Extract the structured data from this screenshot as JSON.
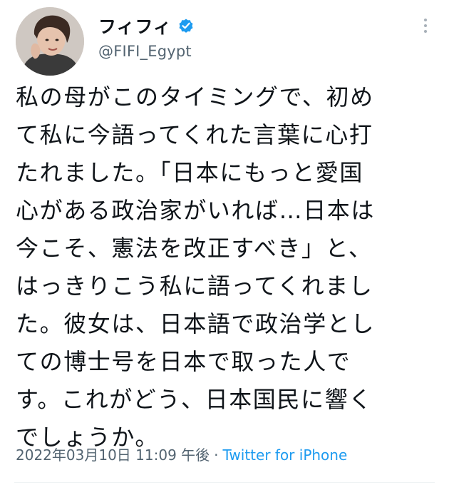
{
  "tweet": {
    "author": {
      "display_name": "フィフィ",
      "handle": "@FIFI_Egypt",
      "verified": true,
      "avatar_icon": "profile-photo"
    },
    "text": "私の母がこのタイミングで、初め\nて私に今語ってくれた言葉に心打\nたれました。「日本にもっと愛国\n心がある政治家がいれば…日本は\n今こそ、憲法を改正すべき」と、\nはっきりこう私に語ってくれまし\nた。彼女は、日本語で政治学とし\nての博士号を日本で取った人で\nす。これがどう、日本国民に響く\nでしょうか。",
    "timestamp": "2022年03月10日 11:09 午後",
    "separator": "·",
    "source": "Twitter for iPhone"
  },
  "colors": {
    "text": "#0f1419",
    "secondary": "#536471",
    "link": "#1d9bf0",
    "verified_badge": "#1d9bf0"
  },
  "icons": {
    "verified": "verified-badge-icon",
    "more": "more-options-icon"
  }
}
